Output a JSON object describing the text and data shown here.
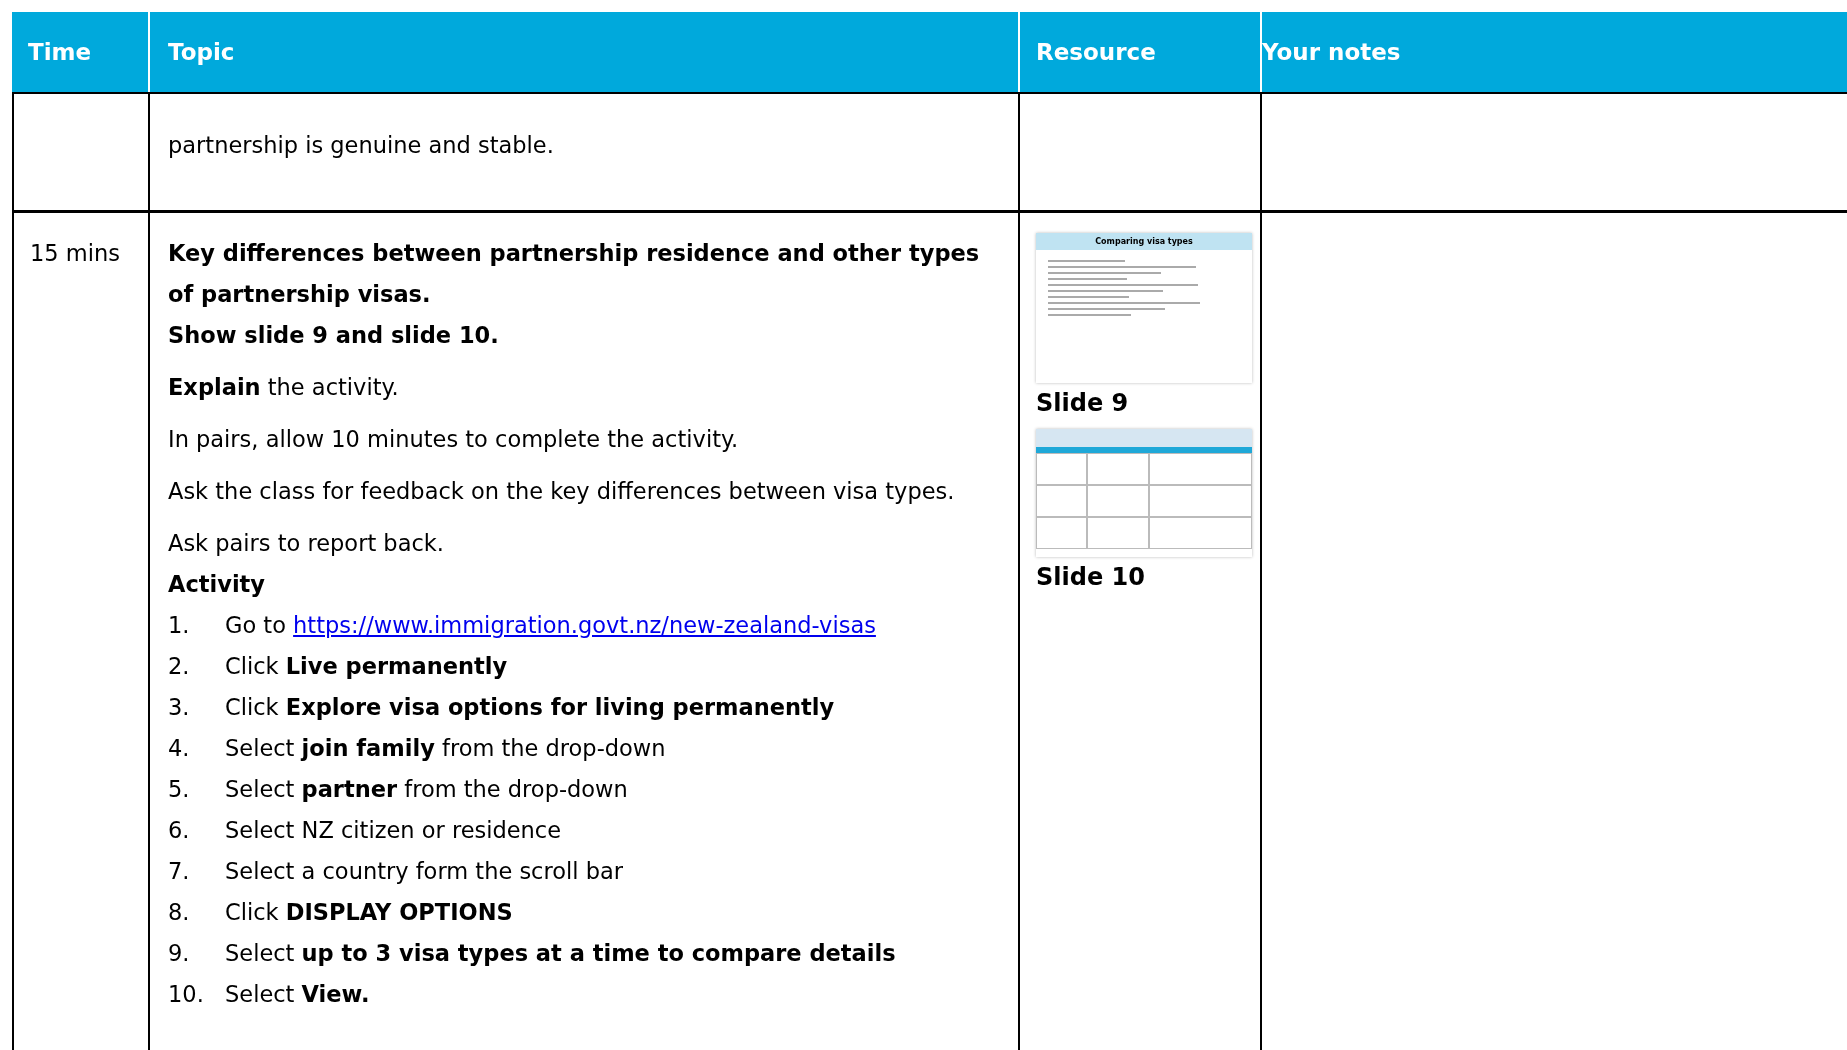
{
  "table": {
    "columns": [
      "Time",
      "Topic",
      "Resource",
      "Your notes"
    ],
    "rows": [
      {
        "time": "",
        "topic": [
          {
            "kind": "para",
            "text": "partnership is genuine and stable."
          }
        ],
        "resources": []
      },
      {
        "time": "15 mins",
        "topic": [
          {
            "kind": "heading",
            "text": "Key differences between partnership residence and other types of partnership visas."
          },
          {
            "kind": "heading",
            "text": "Show slide 9 and slide 10."
          },
          {
            "kind": "para",
            "text": "**Explain** the activity."
          },
          {
            "kind": "para",
            "text": "In pairs, allow 10 minutes to complete the activity."
          },
          {
            "kind": "para",
            "text": "Ask the class for feedback on the key differences between visa types."
          },
          {
            "kind": "para",
            "text": "Ask pairs to report back."
          },
          {
            "kind": "heading",
            "text": "Activity"
          },
          {
            "kind": "list",
            "items": [
              {
                "num": "1.",
                "text": "Go to ",
                "link": "https://www.immigration.govt.nz/new-zealand-visas"
              },
              {
                "num": "2.",
                "text": "Click **Live permanently**"
              },
              {
                "num": "3.",
                "text": "Click **Explore visa options for living permanently**"
              },
              {
                "num": "4.",
                "text": "Select **join family** from the drop-down"
              },
              {
                "num": "5.",
                "text": "Select **partner** from the drop-down"
              },
              {
                "num": "6.",
                "text": "Select NZ citizen or residence"
              },
              {
                "num": "7.",
                "text": "Select a country form the scroll bar"
              },
              {
                "num": "8.",
                "text": "Click **DISPLAY OPTIONS**"
              },
              {
                "num": "9.",
                "text": "Select **up to 3 visa types at a time to compare details**"
              },
              {
                "num": "10.",
                "text": "Select **View.**"
              }
            ]
          }
        ],
        "resources": [
          {
            "kind": "list-slide",
            "title": "Comparing visa types",
            "caption": "Slide 9"
          },
          {
            "kind": "table-slide",
            "caption": "Slide 10"
          }
        ]
      }
    ]
  }
}
